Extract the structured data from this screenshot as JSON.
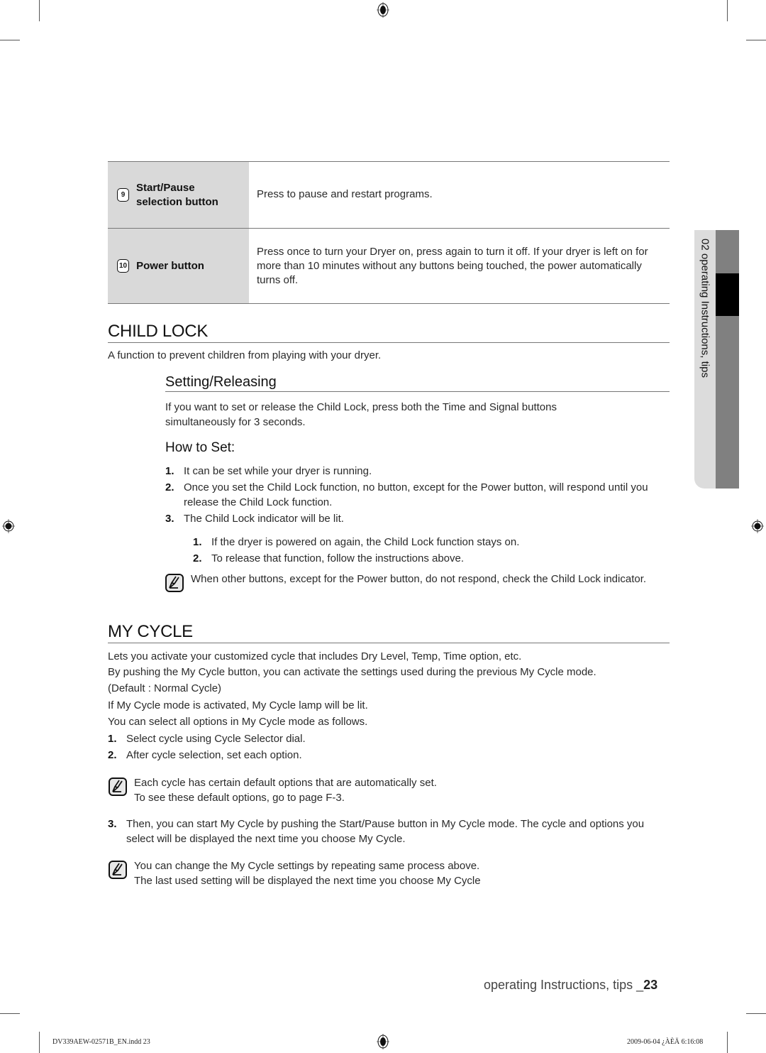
{
  "table": {
    "rows": [
      {
        "number": "9",
        "label_line1": "Start/Pause",
        "label_line2": "selection button",
        "description": "Press to pause and restart programs."
      },
      {
        "number": "10",
        "label_line1": "Power button",
        "label_line2": "",
        "description": "Press once to turn your Dryer on, press again to turn it off. If your dryer is left on for more than 10 minutes without any buttons being touched, the power automatically turns off."
      }
    ]
  },
  "child_lock": {
    "title": "CHILD LOCK",
    "intro": "A function to prevent children from playing with your dryer.",
    "setting_title": "Setting/Releasing",
    "setting_text": "If you want to set or release the Child Lock, press both the Time and Signal buttons simultaneously for 3 seconds.",
    "how_to_set_title": "How to Set:",
    "steps": [
      {
        "n": "1.",
        "text": "It can be set while your dryer is running."
      },
      {
        "n": "2.",
        "text": "Once you set the Child Lock function, no button, except for the Power button, will respond until you release the Child Lock function."
      },
      {
        "n": "3.",
        "text": "The Child Lock indicator will be lit."
      }
    ],
    "sub_steps": [
      {
        "n": "1.",
        "text": "If the dryer is powered on again, the Child Lock function stays on."
      },
      {
        "n": "2.",
        "text": "To release that function, follow the instructions above."
      }
    ],
    "note": "When other buttons, except for the Power button, do not respond, check the Child Lock indicator."
  },
  "my_cycle": {
    "title": "MY CYCLE",
    "paragraphs": [
      "Lets you activate your customized cycle that includes Dry Level, Temp, Time option, etc.",
      "By pushing the My Cycle button, you can activate the settings used during the previous My Cycle mode.",
      "(Default : Normal Cycle)",
      "If My Cycle mode is activated, My Cycle lamp will be lit.",
      "You can select all options in My Cycle mode as follows."
    ],
    "steps": [
      {
        "n": "1.",
        "text": "Select cycle using Cycle Selector dial."
      },
      {
        "n": "2.",
        "text": "After cycle selection, set each option."
      }
    ],
    "note1_line1": "Each cycle has certain default options that are automatically set.",
    "note1_line2": "To see these default options, go to page F-3.",
    "step3": {
      "n": "3.",
      "text": "Then, you can start My Cycle by pushing the Start/Pause button in My Cycle mode. The cycle and options you select will be displayed the next time you choose My Cycle."
    },
    "note2_line1": "You can change the My Cycle settings by repeating same process above.",
    "note2_line2": "The last used setting will be displayed the next time you choose My Cycle"
  },
  "side_tab": {
    "label": "02 operating Instructions, tips"
  },
  "footer": {
    "section": "operating Instructions, tips _",
    "page_number": "23",
    "slug_file": "DV339AEW-02571B_EN.indd   23",
    "slug_date": "2009-06-04   ¿ÀÈÄ 6:16:08"
  }
}
